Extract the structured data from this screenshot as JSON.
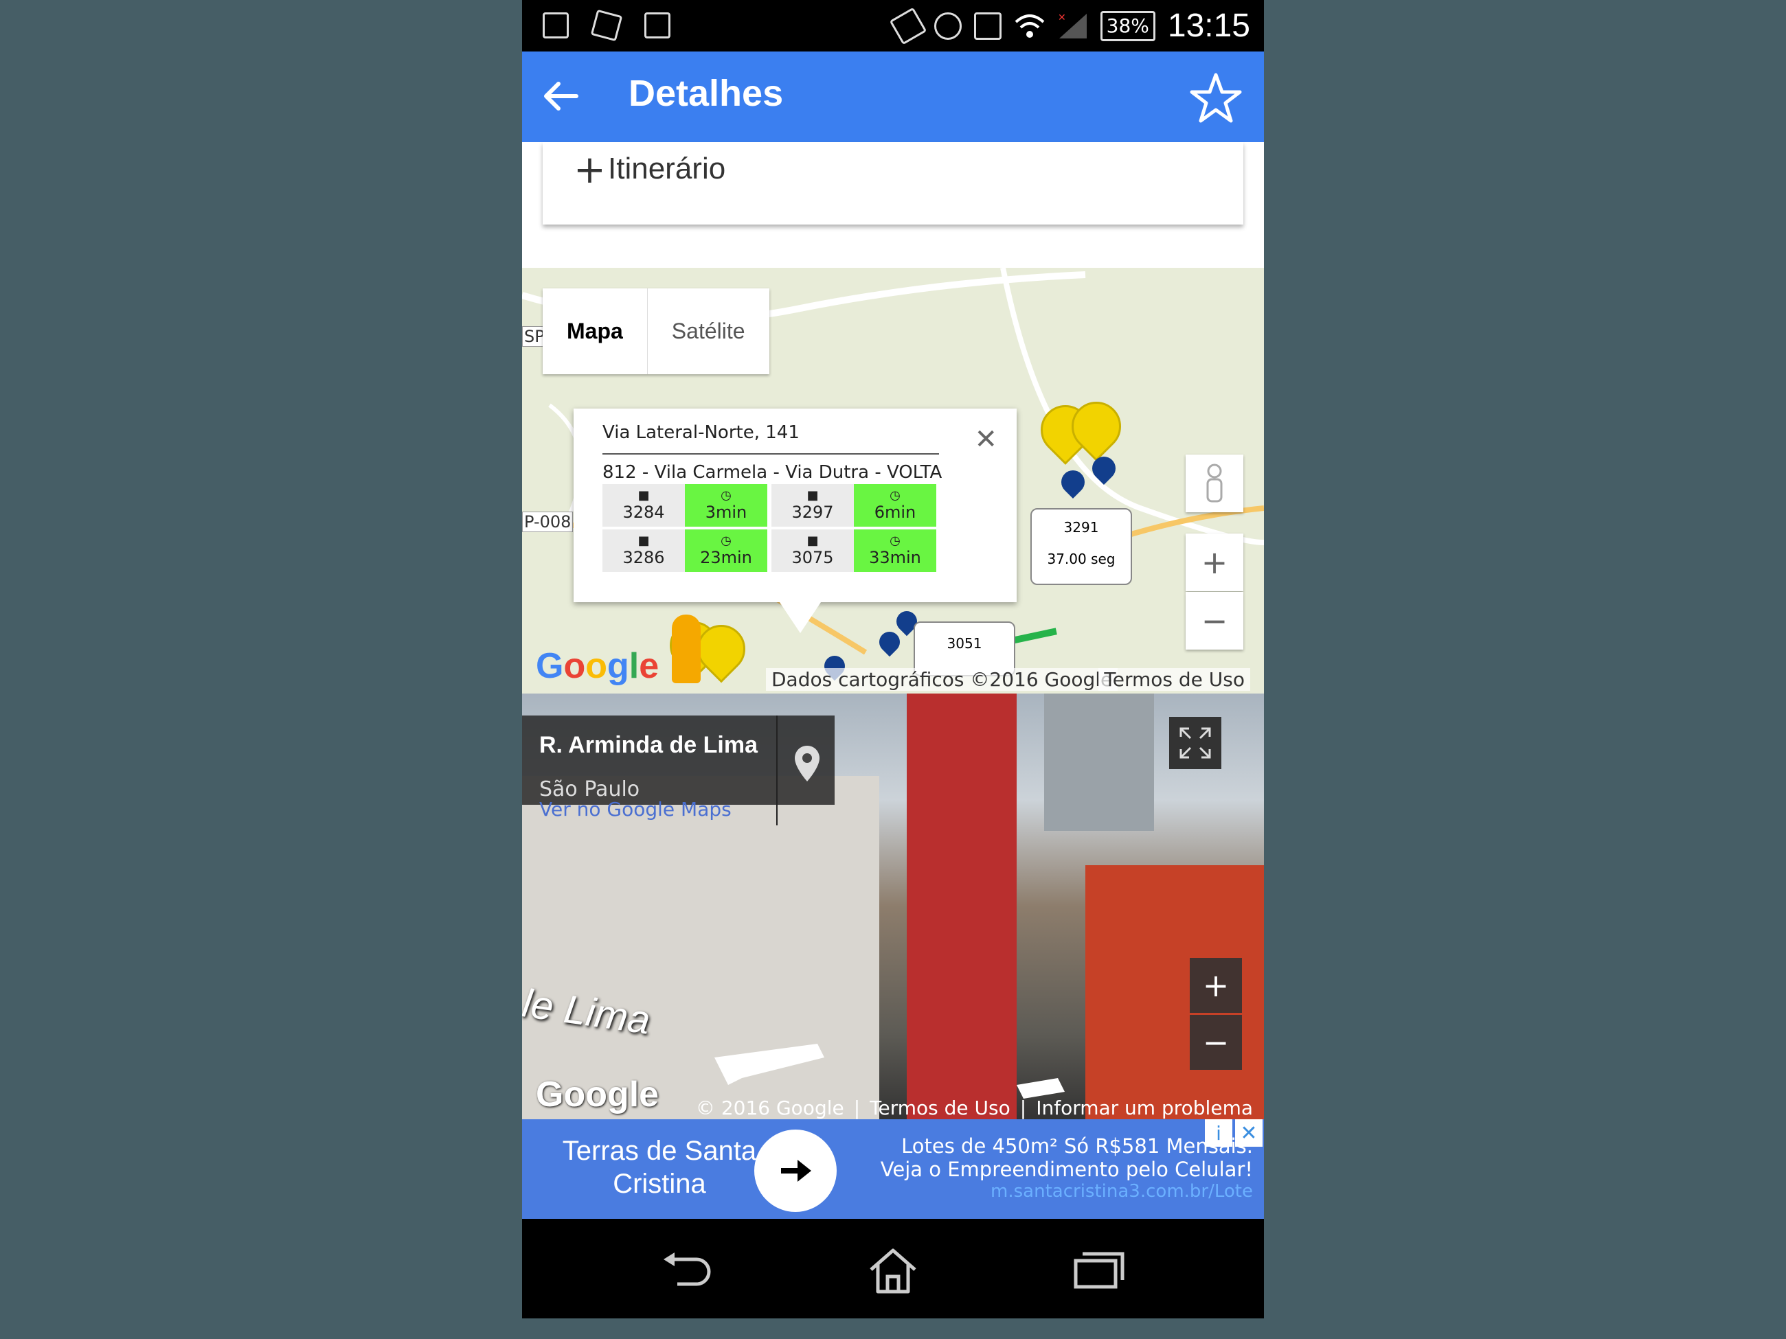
{
  "status_bar": {
    "battery": "38%",
    "time": "13:15",
    "icons": [
      "image-icon",
      "map-icon",
      "checkbox-icon",
      "vibrate-icon",
      "alarm-icon",
      "sd-card-icon",
      "wifi-icon",
      "signal-icon",
      "battery-icon"
    ]
  },
  "app_bar": {
    "title": "Detalhes",
    "back_icon": "arrow-left-icon",
    "favorite_icon": "star-outline-icon",
    "color": "#3b7ff0"
  },
  "itinerary": {
    "plus": "+",
    "label": "Itinerário"
  },
  "map": {
    "toggle": {
      "map_label": "Mapa",
      "satellite_label": "Satélite"
    },
    "popup": {
      "address": "Via Lateral-Norte, 141",
      "route": "812 - Vila Carmela - Via Dutra - VOLTA",
      "arrivals": [
        {
          "bus": "3284",
          "time": "3min"
        },
        {
          "bus": "3297",
          "time": "6min"
        },
        {
          "bus": "3286",
          "time": "23min"
        },
        {
          "bus": "3075",
          "time": "33min"
        }
      ],
      "close": "✕"
    },
    "bus_labels": [
      {
        "bus": "3291",
        "time": "37.00 seg"
      },
      {
        "bus": "3051"
      }
    ],
    "road_labels": [
      "SP",
      "P-008"
    ],
    "zoom_in": "+",
    "zoom_out": "−",
    "logo": "Google",
    "credit": "Dados cartográficos ©2016 Google",
    "terms": "Termos de Uso",
    "time_ok_color": "#69f542",
    "marker_color": "#f2d300",
    "stop_color": "#123e8c"
  },
  "street_view": {
    "title": "R. Arminda de Lima",
    "city": "São Paulo",
    "link": "Ver no Google Maps",
    "street_overlay": "le Lima",
    "logo": "Google",
    "copyright": "© 2016 Google",
    "terms": "Termos de Uso",
    "report": "Informar um problema",
    "zoom_in": "+",
    "zoom_out": "−"
  },
  "ad": {
    "title": "Terras de Santa Cristina",
    "text": "Lotes de 450m² Só R$581 Mensais. Veja o Empreendimento pelo Celular!",
    "url": "m.santacristina3.com.br/Lote",
    "info": "i",
    "close": "✕",
    "color": "#4a7ce0"
  },
  "nav_bar": {
    "icons": [
      "back-nav-icon",
      "home-icon",
      "recents-icon"
    ]
  }
}
